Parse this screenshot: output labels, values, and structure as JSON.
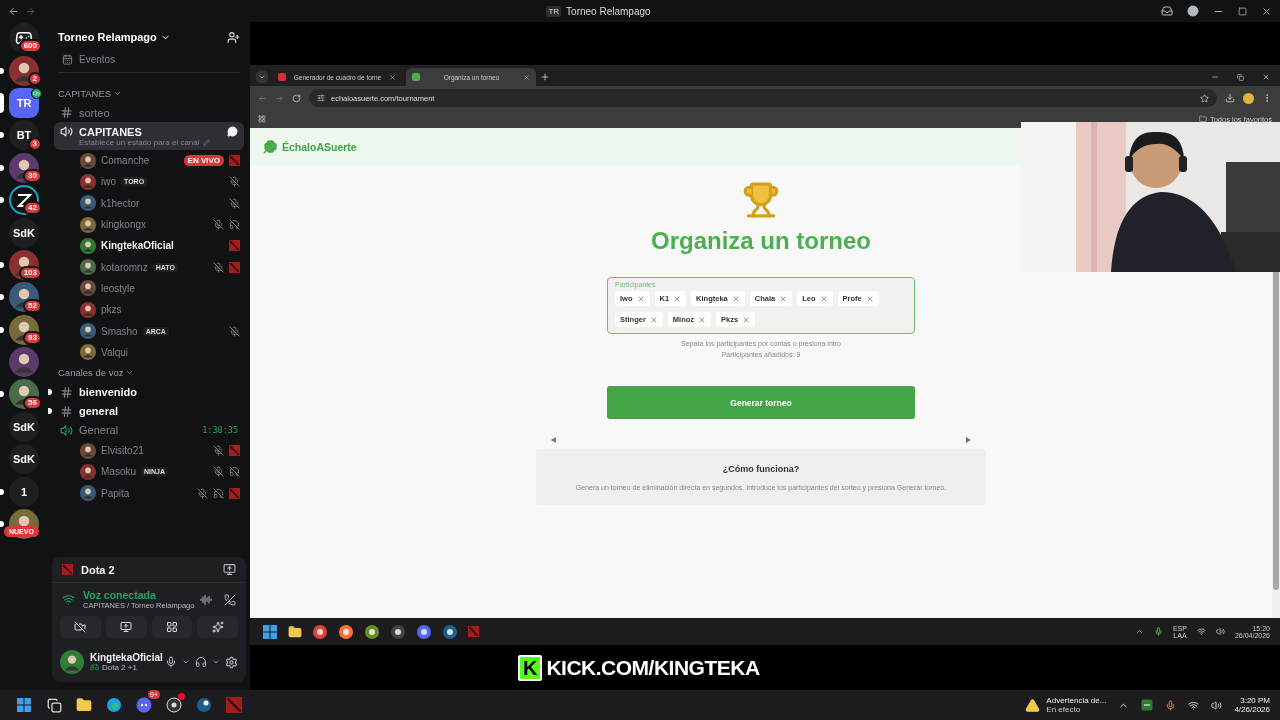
{
  "titlebar": {
    "icon_label": "TR",
    "title": "Torneo Relampago"
  },
  "servers": [
    {
      "kind": "logo",
      "badge": "600",
      "selected": false,
      "unread": false,
      "voice": false
    },
    {
      "kind": "avatar",
      "badge": "2",
      "selected": false,
      "unread": true,
      "voice": false
    },
    {
      "kind": "text",
      "label": "TR",
      "selected": true,
      "unread": false,
      "voice": true
    },
    {
      "kind": "text",
      "label": "BT",
      "badge": "3",
      "selected": false,
      "unread": true,
      "voice": false
    },
    {
      "kind": "avatar",
      "badge": "30",
      "selected": false,
      "unread": true,
      "voice": false
    },
    {
      "kind": "ring",
      "badge": "42",
      "selected": false,
      "unread": true,
      "voice": false
    },
    {
      "kind": "text",
      "label": "SdK",
      "selected": false,
      "unread": false,
      "voice": false
    },
    {
      "kind": "avatar",
      "badge": "103",
      "selected": false,
      "unread": true,
      "voice": false
    },
    {
      "kind": "avatar",
      "badge": "52",
      "selected": false,
      "unread": true,
      "voice": false
    },
    {
      "kind": "avatar",
      "badge": "93",
      "selected": false,
      "unread": true,
      "voice": false
    },
    {
      "kind": "avatar",
      "selected": false,
      "unread": false,
      "voice": false
    },
    {
      "kind": "avatar",
      "badge": "56",
      "selected": false,
      "unread": true,
      "voice": false
    },
    {
      "kind": "text",
      "label": "SdK",
      "selected": false,
      "unread": false,
      "voice": false
    },
    {
      "kind": "text",
      "label": "SdK",
      "selected": false,
      "unread": false,
      "voice": false
    },
    {
      "kind": "text",
      "label": "1",
      "selected": false,
      "unread": true,
      "voice": false
    },
    {
      "kind": "avatar",
      "tag": "NUEVO",
      "selected": false,
      "unread": true,
      "voice": false
    }
  ],
  "server_header": {
    "name": "Torneo Relampago"
  },
  "channels": [
    {
      "kind": "events",
      "name": "Eventos"
    },
    {
      "kind": "category",
      "name": "CAPITANES"
    },
    {
      "kind": "text",
      "name": "sorteo",
      "unread": false
    },
    {
      "kind": "voice",
      "name": "CAPITANES",
      "selected": true,
      "status": "Establece un estado para el canal",
      "members": [
        {
          "name": "Comanche",
          "live": "EN VIVO",
          "speaking": false,
          "muted": false,
          "deafened": false,
          "playing": true
        },
        {
          "name": "iwo",
          "tag": "TORO",
          "speaking": false,
          "muted": true,
          "deafened": false,
          "playing": false
        },
        {
          "name": "k1hector",
          "speaking": false,
          "muted": true,
          "deafened": false,
          "playing": false
        },
        {
          "name": "kingkongx",
          "speaking": false,
          "muted": true,
          "deafened": true,
          "playing": false
        },
        {
          "name": "KingtekaOficial",
          "speaking": true,
          "muted": false,
          "deafened": false,
          "playing": true
        },
        {
          "name": "kotaromnz",
          "tag": "HATO",
          "speaking": false,
          "muted": true,
          "deafened": false,
          "playing": true
        },
        {
          "name": "leostyle",
          "speaking": false,
          "muted": false,
          "deafened": false,
          "playing": false
        },
        {
          "name": "pkzs",
          "speaking": false,
          "muted": false,
          "deafened": false,
          "playing": false
        },
        {
          "name": "Smasho",
          "tag": "ARCA",
          "speaking": false,
          "muted": true,
          "deafened": false,
          "playing": false
        },
        {
          "name": "Valqui",
          "speaking": false,
          "muted": false,
          "deafened": false,
          "playing": false
        }
      ]
    },
    {
      "kind": "category",
      "name": "Canales de voz"
    },
    {
      "kind": "text",
      "name": "bienvenido",
      "unread": true
    },
    {
      "kind": "text",
      "name": "general",
      "unread": true
    },
    {
      "kind": "voice",
      "name": "General",
      "selected": false,
      "timer": "1:30:35",
      "members": [
        {
          "name": "Elvisito21",
          "speaking": false,
          "muted": true,
          "deafened": false,
          "playing": true
        },
        {
          "name": "Masoku",
          "tag": "NINJA",
          "speaking": false,
          "muted": true,
          "deafened": true,
          "playing": false
        },
        {
          "name": "Papita",
          "speaking": false,
          "muted": true,
          "deafened": true,
          "playing": true
        }
      ]
    }
  ],
  "activity": {
    "game": "Dota 2"
  },
  "voice_status": {
    "label": "Voz conectada",
    "channel": "CAPITANES / Torneo Relampago"
  },
  "user": {
    "name": "KingtekaOficial",
    "status": "Dota 2 +1"
  },
  "browser": {
    "tabs": [
      {
        "title": "Generador de cuadro de torne",
        "selected": false
      },
      {
        "title": "Organiza un torneo",
        "selected": true
      }
    ],
    "url": "echaloasuerte.com/tournament",
    "bookmarks": "Todos los favoritos"
  },
  "page": {
    "logo": "ÉchaloASuerte",
    "heading": "Organiza un torneo",
    "field_label": "Participantes",
    "participants": [
      "Iwo",
      "K1",
      "Kingteka",
      "Chala",
      "Leo",
      "Profe",
      "Stinger",
      "Minoz",
      "Pkzs"
    ],
    "hint": "Separa los participantes por comas o presiona intro",
    "count": "Participantes añadidos: 9",
    "button": "Generar torneo",
    "info_title": "¿Cómo funciona?",
    "info_text": "Genera un torneo de eliminación directa en segundos. Introduce los participantes del sorteo y presiona Generar torneo."
  },
  "stream_taskbar": {
    "lang": "ESP",
    "region": "LAA",
    "time": "15:20",
    "date": "26/04/2026"
  },
  "overlay": {
    "logo_letter": "K",
    "text": "KICK.COM/KINGTEKA"
  },
  "taskbar": {
    "discord_badge": "9+",
    "notice_title": "Advertencia de...",
    "notice_sub": "En efecto",
    "time": "3:20 PM",
    "date": "4/26/2026"
  }
}
